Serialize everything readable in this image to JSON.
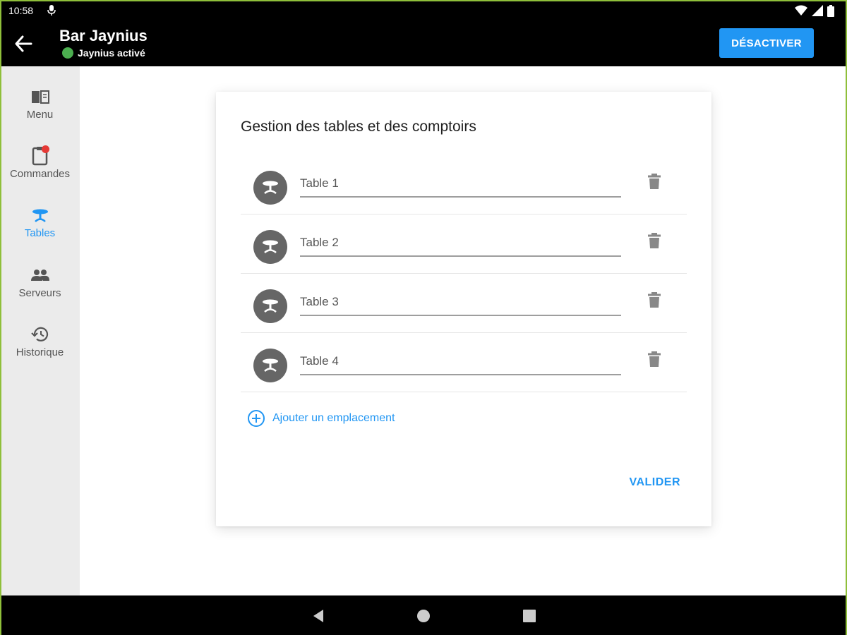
{
  "status": {
    "time": "10:58"
  },
  "header": {
    "title": "Bar Jaynius",
    "subtitle": "Jaynius activé",
    "status_color": "#4caf50",
    "deactivate_label": "DÉSACTIVER",
    "accent": "#2196f3"
  },
  "sidebar": {
    "items": [
      {
        "label": "Menu",
        "icon": "menu-book-icon",
        "active": false
      },
      {
        "label": "Commandes",
        "icon": "orders-icon",
        "active": false,
        "badge": true
      },
      {
        "label": "Tables",
        "icon": "table-icon",
        "active": true
      },
      {
        "label": "Serveurs",
        "icon": "people-icon",
        "active": false
      },
      {
        "label": "Historique",
        "icon": "history-icon",
        "active": false
      }
    ]
  },
  "card": {
    "title": "Gestion des tables et des comptoirs",
    "tables": [
      {
        "value": "Table 1"
      },
      {
        "value": "Table 2"
      },
      {
        "value": "Table 3"
      },
      {
        "value": "Table 4"
      }
    ],
    "add_label": "Ajouter un emplacement",
    "validate_label": "VALIDER"
  },
  "nav": {
    "icons": [
      "back-triangle-icon",
      "home-circle-icon",
      "recents-square-icon"
    ]
  }
}
